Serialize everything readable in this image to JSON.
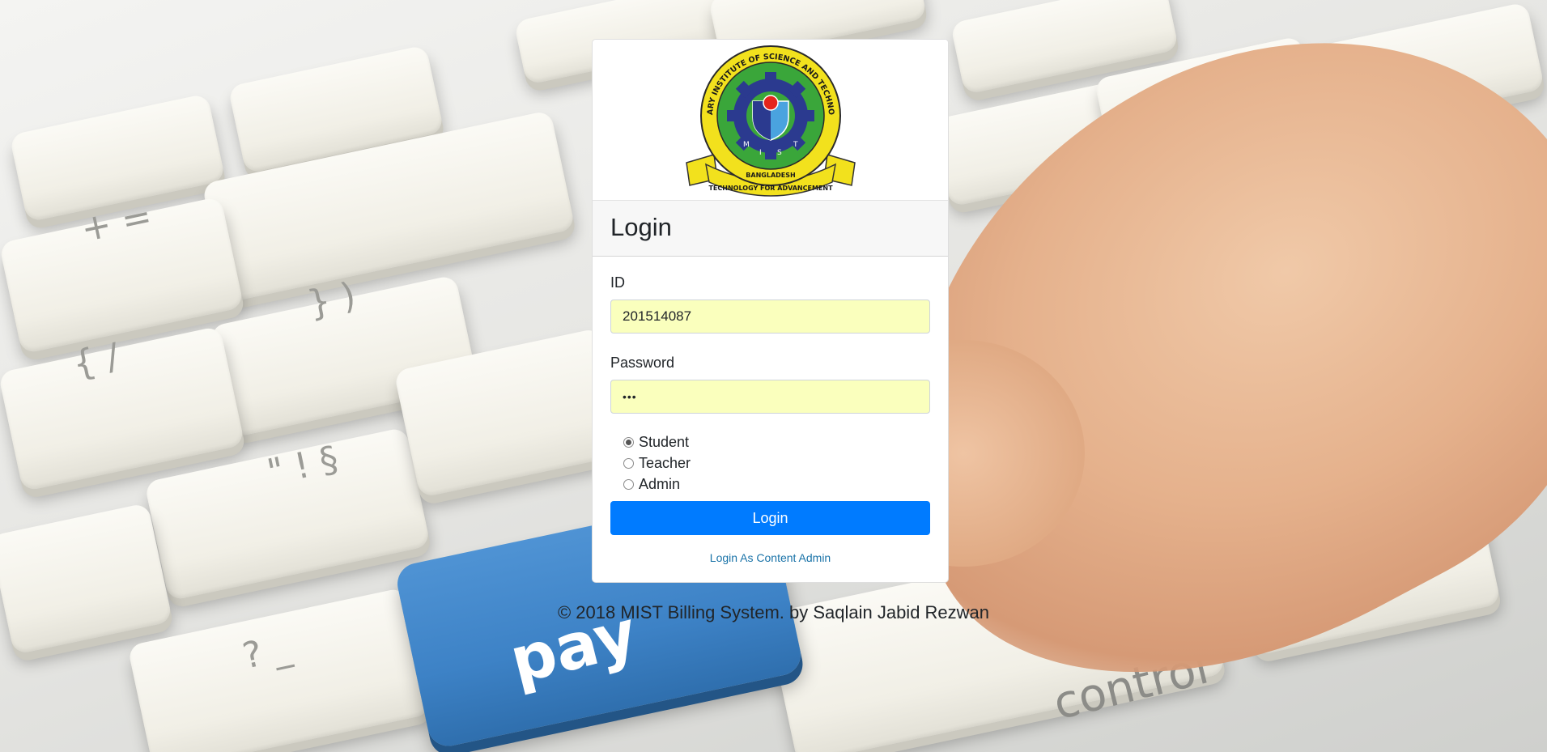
{
  "logo": {
    "arc_text": "MILITARY INSTITUTE OF SCIENCE AND TECHNOLOGY",
    "ribbon_country": "BANGLADESH",
    "ribbon_motto": "TECHNOLOGY FOR ADVANCEMENT",
    "letters": [
      "M",
      "I",
      "S",
      "T"
    ],
    "colors": {
      "ring": "#f2e11d",
      "green": "#3aa63a",
      "gear": "#2b3a8f",
      "red": "#e4241c",
      "blue": "#4aa3df"
    }
  },
  "background": {
    "pay_key": "pay",
    "control_key": "control"
  },
  "card": {
    "title": "Login",
    "id_label": "ID",
    "id_value": "201514087",
    "password_label": "Password",
    "password_value": "•••",
    "roles": [
      {
        "label": "Student",
        "checked": true
      },
      {
        "label": "Teacher",
        "checked": false
      },
      {
        "label": "Admin",
        "checked": false
      }
    ],
    "login_button": "Login",
    "content_admin_link": "Login As Content Admin"
  },
  "footer": {
    "text": "© 2018 MIST Billing System. by Saqlain Jabid Rezwan"
  },
  "colors": {
    "primary": "#007bff",
    "autofill": "#faffbd",
    "link": "#1a73a8"
  }
}
